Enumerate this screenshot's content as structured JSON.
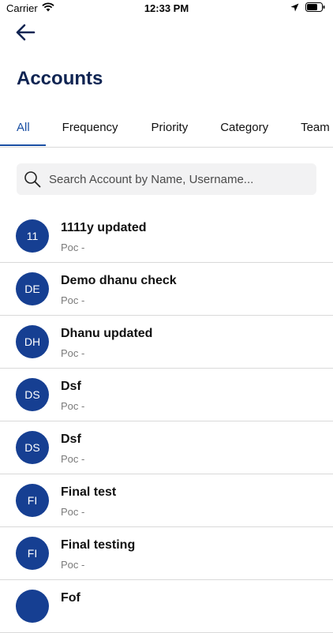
{
  "status_bar": {
    "carrier": "Carrier",
    "time": "12:33 PM"
  },
  "header": {
    "title": "Accounts"
  },
  "tabs": [
    {
      "label": "All",
      "active": true
    },
    {
      "label": "Frequency",
      "active": false
    },
    {
      "label": "Priority",
      "active": false
    },
    {
      "label": "Category",
      "active": false
    },
    {
      "label": "Team",
      "active": false
    }
  ],
  "search": {
    "placeholder": "Search Account by Name, Username..."
  },
  "accounts": [
    {
      "initials": "11",
      "name": "1111y updated",
      "poc": "Poc -"
    },
    {
      "initials": "DE",
      "name": "Demo dhanu check",
      "poc": "Poc -"
    },
    {
      "initials": "DH",
      "name": "Dhanu updated",
      "poc": "Poc -"
    },
    {
      "initials": "DS",
      "name": "Dsf",
      "poc": "Poc -"
    },
    {
      "initials": "DS",
      "name": "Dsf",
      "poc": "Poc -"
    },
    {
      "initials": "FI",
      "name": "Final test",
      "poc": "Poc -"
    },
    {
      "initials": "FI",
      "name": "Final testing",
      "poc": "Poc -"
    },
    {
      "initials": "",
      "name": "Fof",
      "poc": ""
    }
  ],
  "colors": {
    "accent": "#1a4fa3",
    "title": "#0f2452",
    "avatar": "#163f92"
  },
  "icons": {
    "back": "arrow-left-icon",
    "search": "search-icon",
    "wifi": "wifi-icon",
    "location": "location-arrow-icon",
    "battery": "battery-icon"
  }
}
